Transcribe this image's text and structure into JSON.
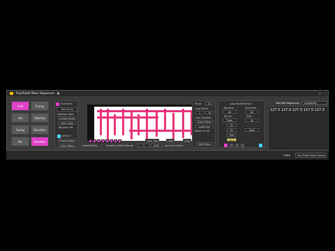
{
  "window": {
    "title": "PolyTriplet Wave Sequencer"
  },
  "nav": [
    "Grid",
    "Transp",
    "Vel",
    "Velocity",
    "Swing",
    "Duration",
    "Pos",
    "Random"
  ],
  "left": {
    "enable": "Overdrive",
    "value": "100.00 ms",
    "options_label": "Mutation Rate",
    "btn1": "Create Synth",
    "btn2": "Clone Step",
    "random_off": "Random Off",
    "active": "Active ?",
    "btn3": "Freeze Steps",
    "btn4": "Clone Steps"
  },
  "seq_footer": {
    "global_delay": "Global Delay",
    "duration_range": "Duration (Wide) Range",
    "range_min": "0",
    "range_max": "1000",
    "clear": "Clear",
    "copy": "Copy Seq",
    "loop": "Loop",
    "ascii": "ascii ctrl output"
  },
  "mid": {
    "steps_label": "Steps",
    "steps_value": "16",
    "loop_points": "Loop Points",
    "loop_start": "1",
    "loop_end": "16",
    "loop_dir": "Loop Direction",
    "dir_button": "Zoom Move",
    "loop_link": "Loop Link",
    "repeat": "Reset on Off",
    "midi_menu": "MIDI Menu"
  },
  "loopmod": {
    "title": "Loop Modifications",
    "col1": "Random",
    "col2": "Scramble",
    "v1": "All",
    "v2": "All",
    "r2a": "Rpt All",
    "r2b": "Shift",
    "r3a": "Flash",
    "r3b": "All",
    "r4": "On",
    "r5a": "On",
    "r5b": "Beat",
    "r6": "Sort",
    "r7": "Zero"
  },
  "textedit": {
    "title": "Text Edit Sequences",
    "menu": "probability",
    "content": "127 0 127 0 127 0 127 0 127 0"
  },
  "statusbar": {
    "midi": "1 MIDI",
    "device": "PolyTriplet Wave Seque"
  }
}
